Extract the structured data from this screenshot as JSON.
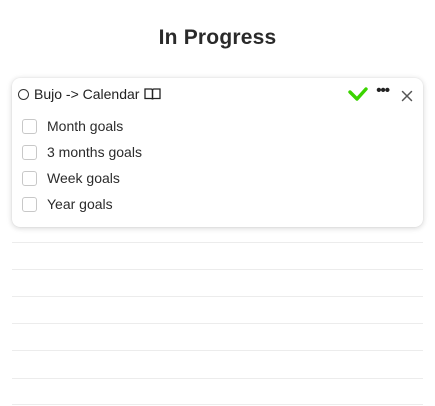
{
  "column": {
    "title": "In Progress"
  },
  "card": {
    "title": "Bujo -> Calendar",
    "icons": {
      "status": "circle-icon",
      "book": "book-icon",
      "complete": "check-icon",
      "more": "more-icon",
      "close": "close-icon"
    },
    "check_color": "#3bd400",
    "more_label": "•••",
    "tasks": [
      {
        "label": "Month goals",
        "checked": false
      },
      {
        "label": "3 months goals",
        "checked": false
      },
      {
        "label": "Week goals",
        "checked": false
      },
      {
        "label": "Year goals",
        "checked": false
      }
    ]
  }
}
